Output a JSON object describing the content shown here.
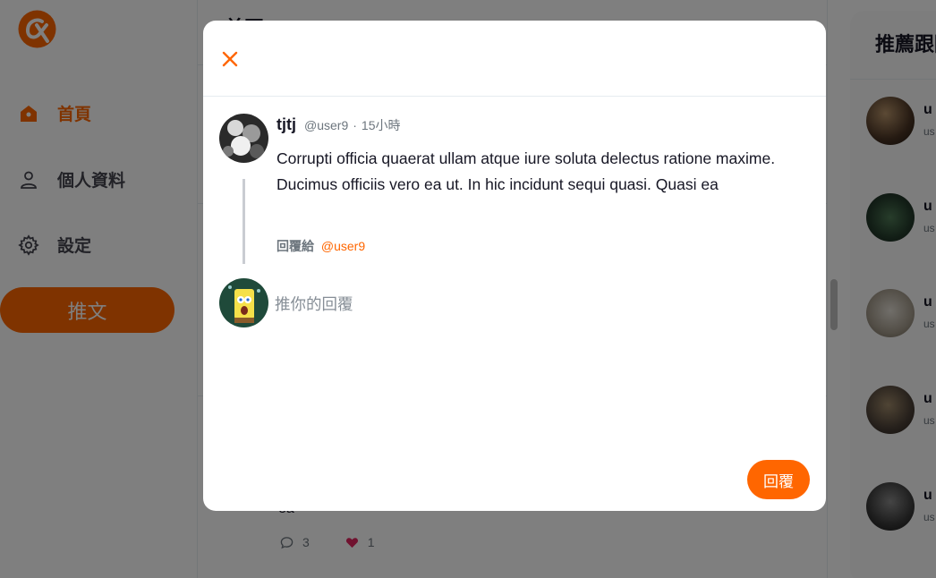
{
  "sidebar": {
    "nav": [
      {
        "label": "首頁",
        "icon": "home-icon",
        "active": true
      },
      {
        "label": "個人資料",
        "icon": "user-icon",
        "active": false
      },
      {
        "label": "設定",
        "icon": "gear-icon",
        "active": false
      }
    ],
    "tweet_button": "推文"
  },
  "main": {
    "title": "首頁",
    "tweet_tail": "ea",
    "reply_count": "3",
    "like_count": "1"
  },
  "right": {
    "title": "推薦跟隨",
    "users": [
      {
        "name": "u",
        "handle": "us"
      },
      {
        "name": "u",
        "handle": "us"
      },
      {
        "name": "u",
        "handle": "us"
      },
      {
        "name": "u",
        "handle": "us"
      },
      {
        "name": "u",
        "handle": "us"
      }
    ]
  },
  "modal": {
    "post": {
      "name": "tjtj",
      "handle": "@user9",
      "separator": "·",
      "time": "15小時",
      "body": "Corrupti officia quaerat ullam atque iure soluta delectus ratione maxime. Ducimus officiis vero ea ut. In hic incidunt sequi quasi. Quasi ea",
      "reply_to_label": "回覆給",
      "reply_to_user": "@user9"
    },
    "compose": {
      "placeholder": "推你的回覆",
      "value": ""
    },
    "reply_button": "回覆"
  },
  "colors": {
    "accent": "#ff6600",
    "muted": "#6c757d",
    "text": "#171725",
    "overlay": "rgba(0,0,0,0.5)"
  }
}
